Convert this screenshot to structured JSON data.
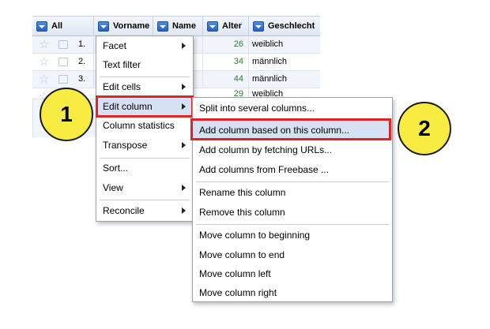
{
  "table": {
    "columns": [
      {
        "label": "All"
      },
      {
        "label": "Vorname"
      },
      {
        "label": "Name"
      },
      {
        "label": "Alter"
      },
      {
        "label": "Geschlecht"
      }
    ],
    "rows": [
      {
        "index": "1.",
        "name_fragment": "",
        "alter": "26",
        "geschlecht": "weiblich"
      },
      {
        "index": "2.",
        "name_fragment": "s",
        "alter": "34",
        "geschlecht": "männlich"
      },
      {
        "index": "3.",
        "name_fragment": "",
        "alter": "44",
        "geschlecht": "männlich"
      },
      {
        "index": "",
        "name_fragment": "",
        "alter": "29",
        "geschlecht": "weiblich"
      }
    ]
  },
  "column_menu": {
    "items": [
      {
        "label": "Facet",
        "submenu": true
      },
      {
        "label": "Text filter",
        "submenu": false
      },
      {
        "label": "Edit cells",
        "submenu": true
      },
      {
        "label": "Edit column",
        "submenu": true
      },
      {
        "label": "Column statistics",
        "submenu": false
      },
      {
        "label": "Transpose",
        "submenu": true
      },
      {
        "label": "Sort...",
        "submenu": false
      },
      {
        "label": "View",
        "submenu": true
      },
      {
        "label": "Reconcile",
        "submenu": true
      }
    ]
  },
  "edit_column_submenu": {
    "items": [
      {
        "label": "Split into several columns..."
      },
      {
        "label": "Add column based on this column..."
      },
      {
        "label": "Add column by fetching URLs..."
      },
      {
        "label": "Add columns from Freebase ..."
      },
      {
        "label": "Rename this column"
      },
      {
        "label": "Remove this column"
      },
      {
        "label": "Move column to beginning"
      },
      {
        "label": "Move column to end"
      },
      {
        "label": "Move column left"
      },
      {
        "label": "Move column right"
      }
    ]
  },
  "badges": {
    "step1": "1",
    "step2": "2"
  },
  "colors": {
    "highlight": "#e02424",
    "badge_fill": "#f8ec42",
    "number_green": "#2e7d32"
  }
}
